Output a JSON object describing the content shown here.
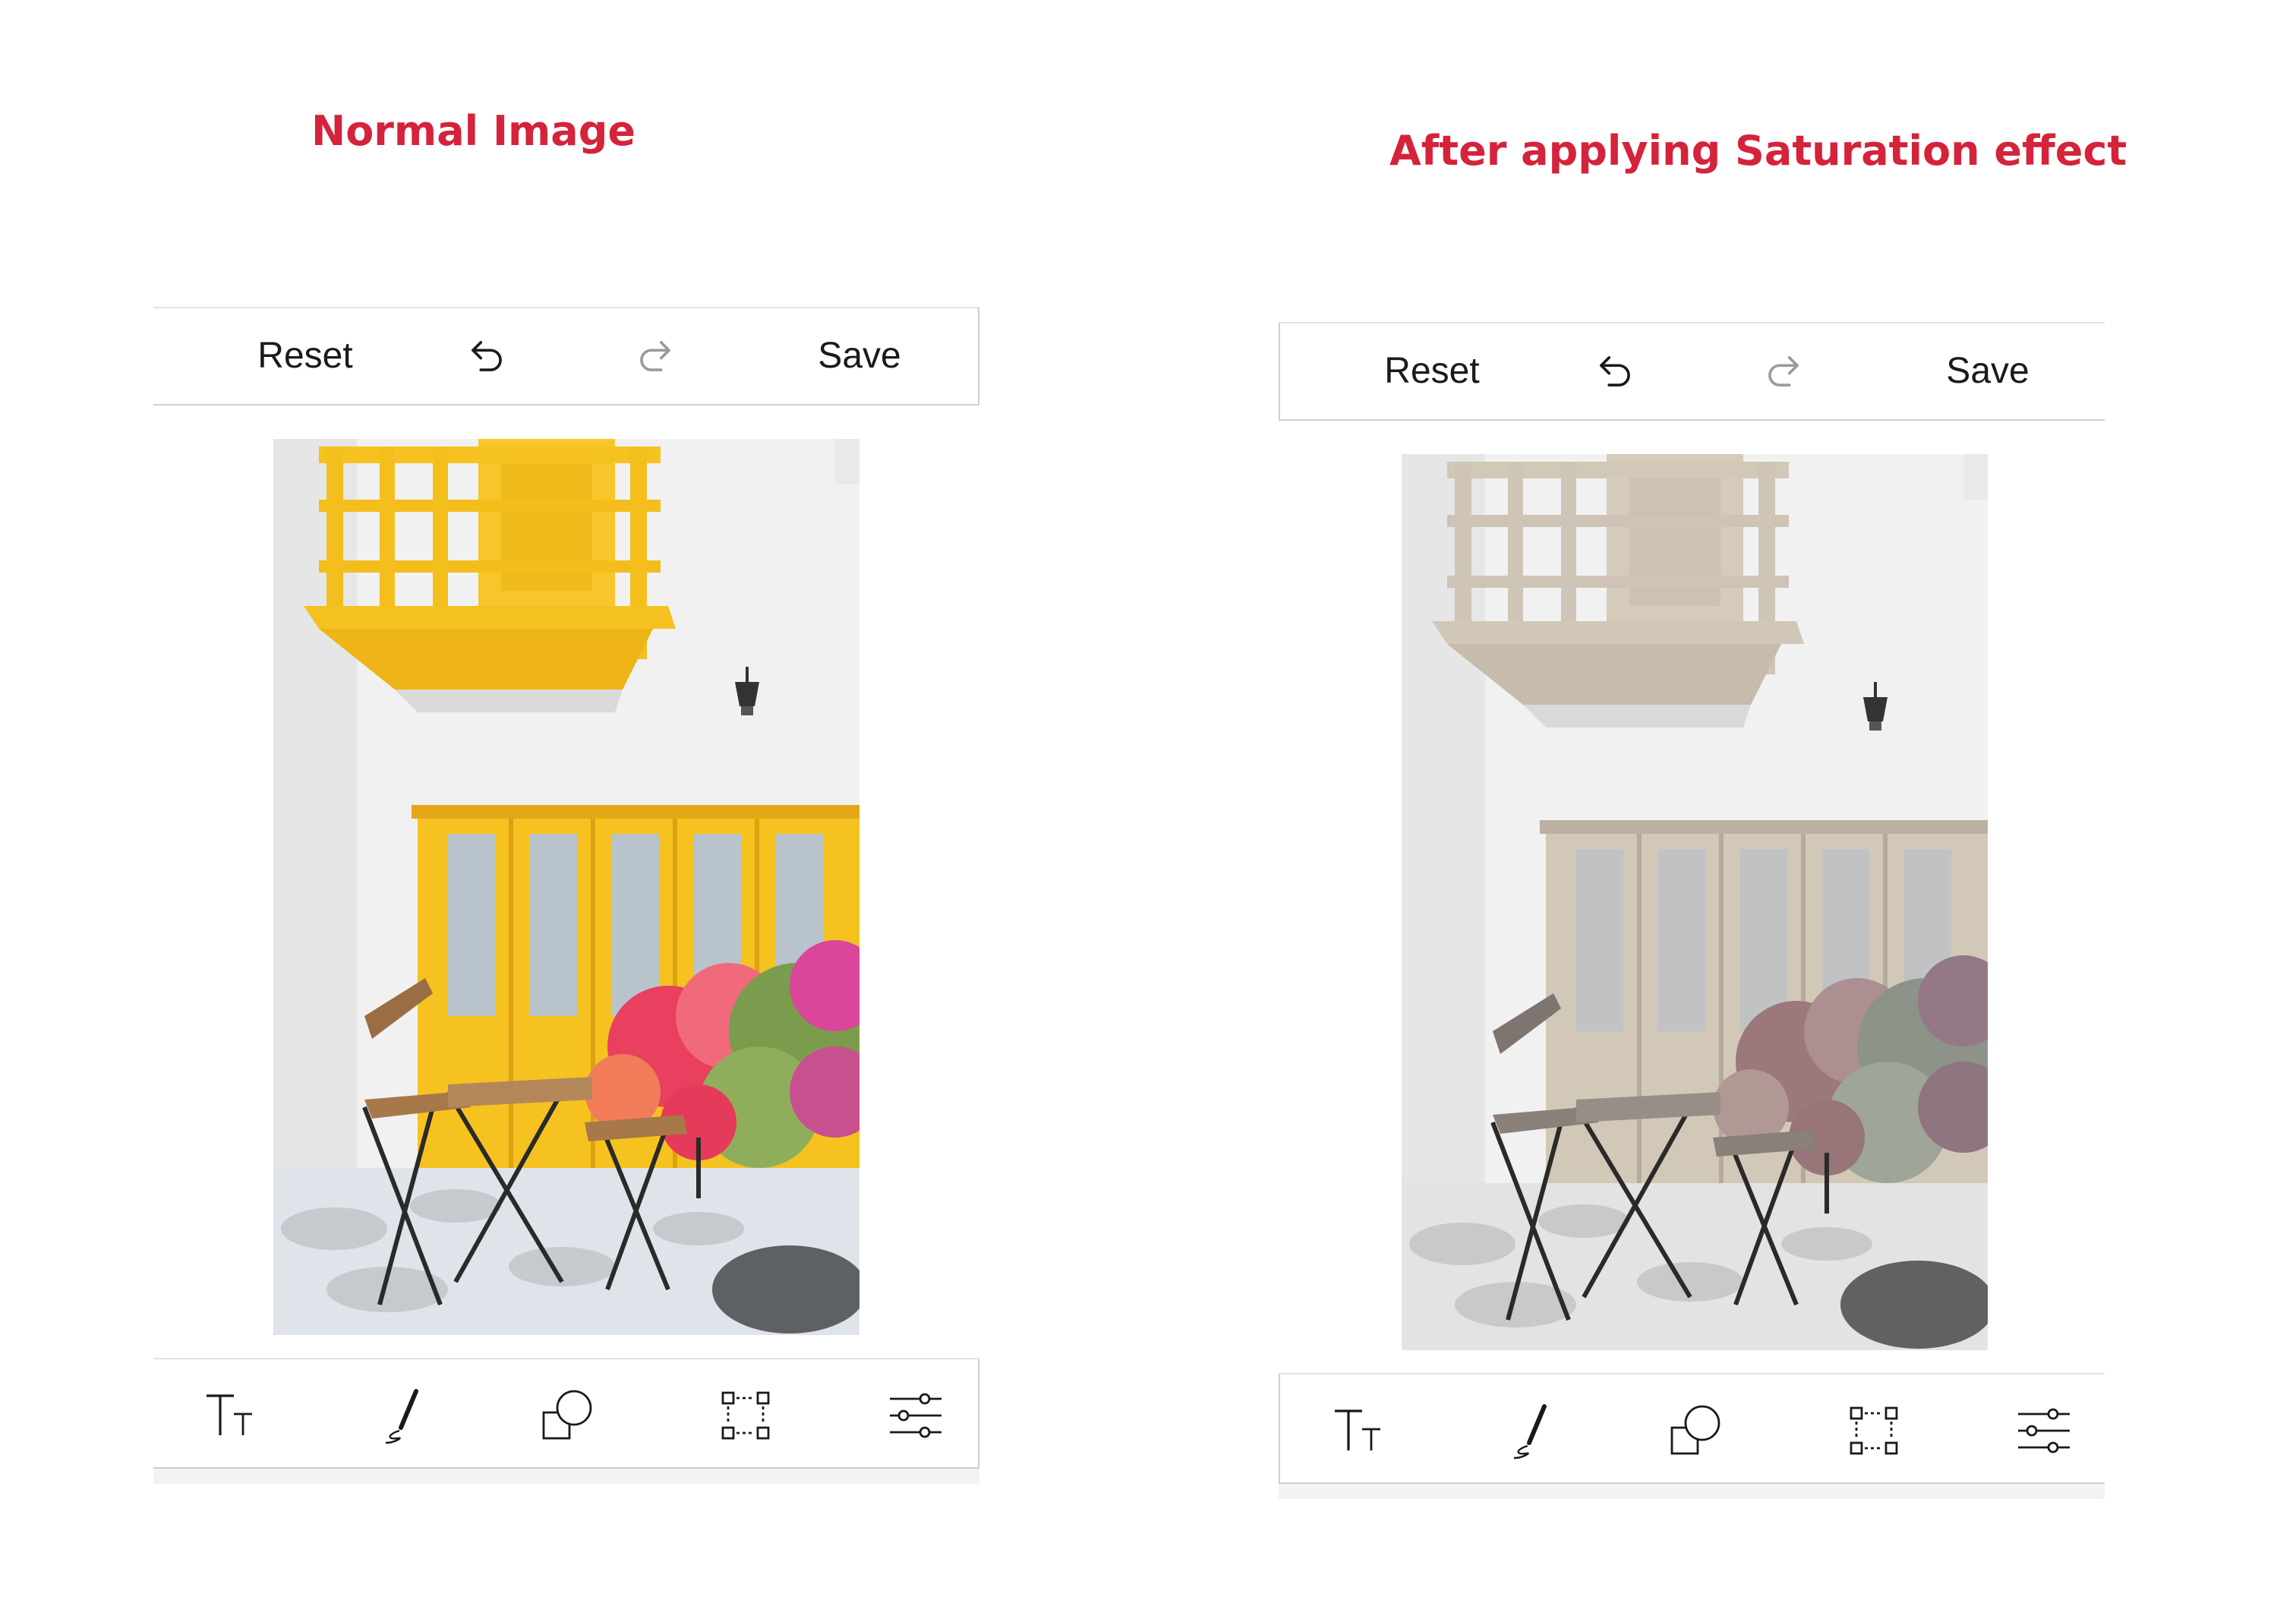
{
  "captions": {
    "left": "Normal Image",
    "right": "After applying Saturation effect"
  },
  "toolbar": {
    "reset_label": "Reset",
    "save_label": "Save"
  },
  "icons": {
    "undo": "undo-icon",
    "redo": "redo-icon",
    "text": "text-icon",
    "pen": "pen-draw-icon",
    "shapes": "shapes-icon",
    "transform": "transform-icon",
    "adjust": "adjust-sliders-icon"
  },
  "colors": {
    "caption": "#d4233a",
    "balcony_normal": "#f4c01e",
    "balcony_saturation": "#e6d7bd",
    "icon_stroke": "#1a1a1a",
    "redo_disabled": "#9a9a9a"
  },
  "saturation_effect": {
    "left_panel_saturation_percent": 100,
    "right_panel_saturation_percent": 18
  }
}
